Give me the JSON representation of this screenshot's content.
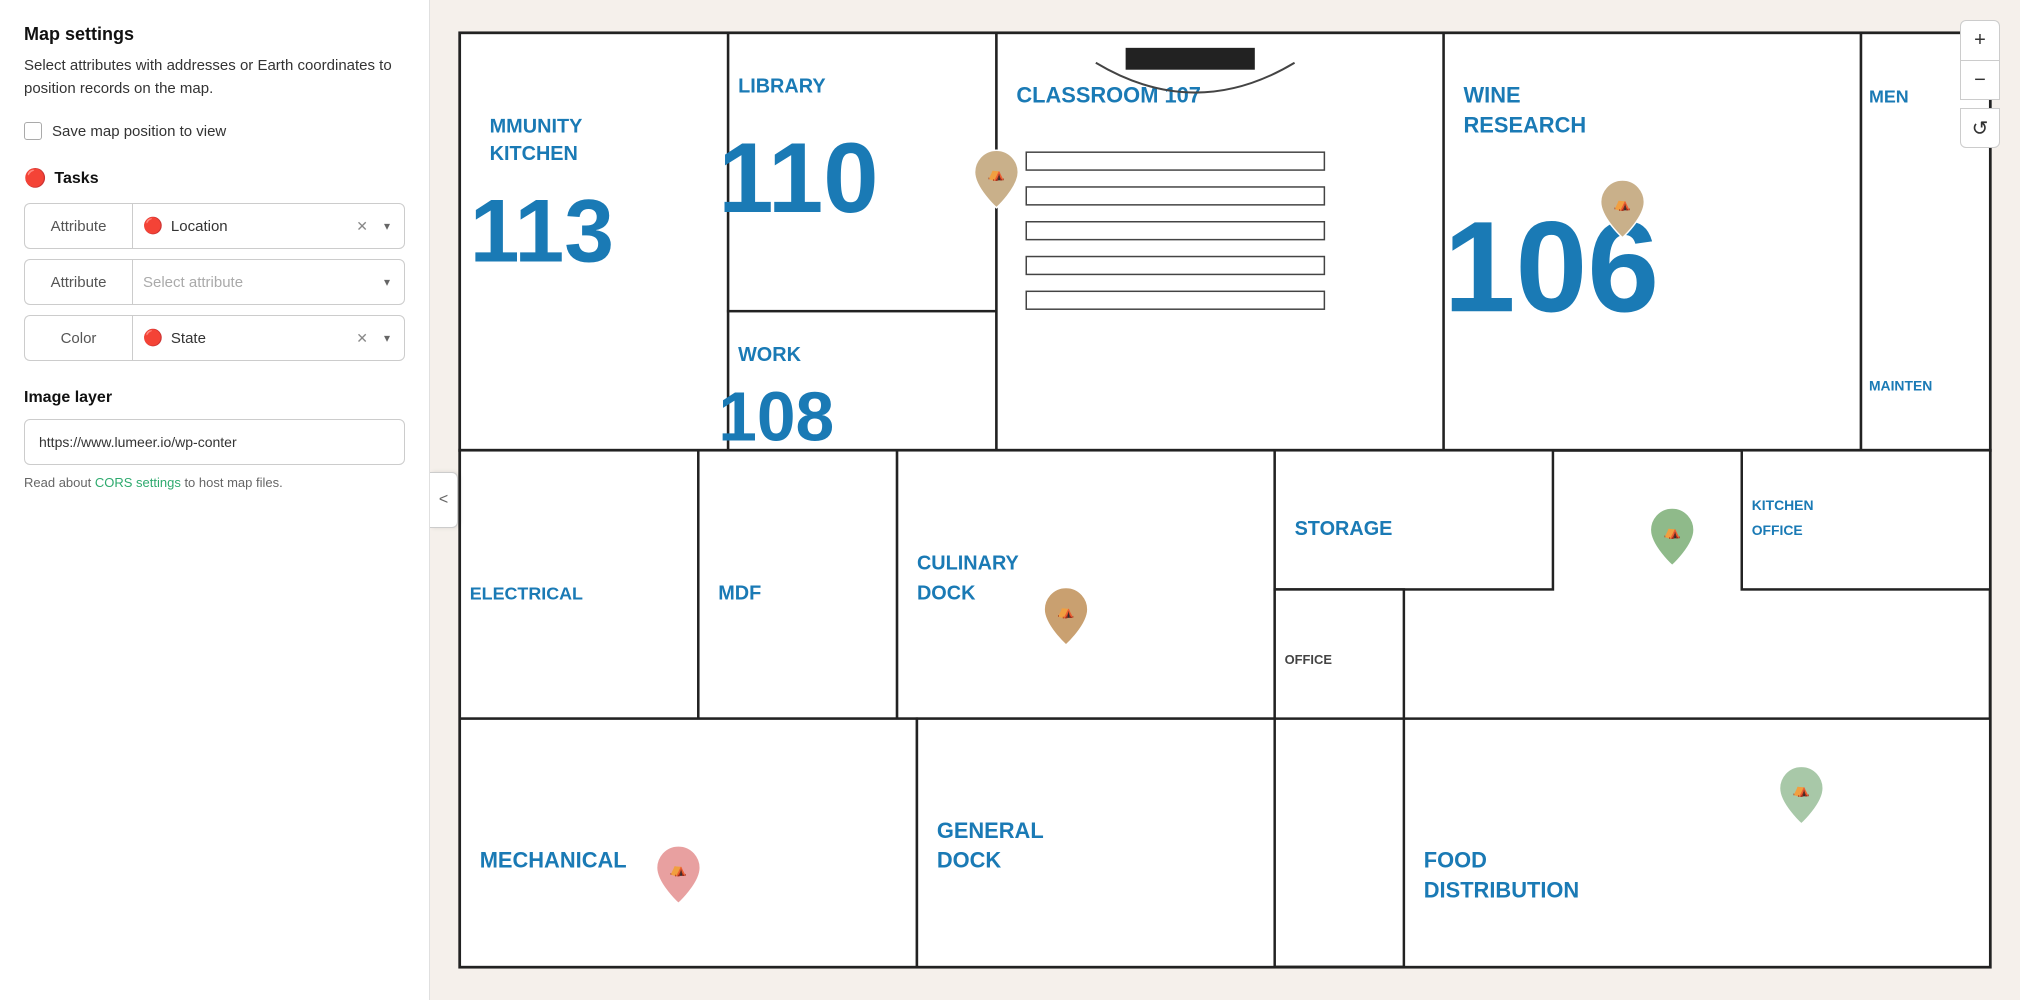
{
  "panel": {
    "title": "Map settings",
    "description": "Select attributes with addresses or Earth coordinates to position records on the map.",
    "save_position_label": "Save map position to view",
    "tasks_section_label": "Tasks",
    "tasks_icon": "🔴",
    "attribute_rows": [
      {
        "id": "row1",
        "label_type": "Attribute",
        "selected_value": "Location",
        "has_value": true,
        "icon": "🔴"
      },
      {
        "id": "row2",
        "label_type": "Attribute",
        "selected_value": "",
        "placeholder": "Select attribute",
        "has_value": false,
        "icon": ""
      },
      {
        "id": "row3",
        "label_type": "Color",
        "selected_value": "State",
        "has_value": true,
        "icon": "🔴"
      }
    ],
    "image_layer_title": "Image layer",
    "image_url_value": "https://www.lumeer.io/wp-conter",
    "cors_note_before": "Read about ",
    "cors_link_text": "CORS settings",
    "cors_note_after": " to host map files."
  },
  "map": {
    "rooms": [
      {
        "id": "r113",
        "name": "MMUNITY\nKITCHEN",
        "number": "113"
      },
      {
        "id": "r110",
        "name": "LIBRARY",
        "number": "110"
      },
      {
        "id": "r107",
        "name": "CLASSROOM 107",
        "number": ""
      },
      {
        "id": "r106",
        "name": "WINE\nRESEARCH",
        "number": "106"
      },
      {
        "id": "r108",
        "name": "WORK",
        "number": "108"
      },
      {
        "id": "electrical",
        "name": "ELECTRICAL",
        "number": ""
      },
      {
        "id": "mdf",
        "name": "MDF",
        "number": ""
      },
      {
        "id": "culinary",
        "name": "CULINARY\nDOCK",
        "number": ""
      },
      {
        "id": "storage",
        "name": "STORAGE",
        "number": ""
      },
      {
        "id": "office",
        "name": "OFFICE",
        "number": ""
      },
      {
        "id": "mechanical",
        "name": "MECHANICAL",
        "number": ""
      },
      {
        "id": "general_dock",
        "name": "GENERAL\nDOCK",
        "number": ""
      },
      {
        "id": "food_dist",
        "name": "FOOD\nDISTRIBUTION",
        "number": ""
      },
      {
        "id": "kitchen_office",
        "name": "KITCHEN\nOFFICE",
        "number": ""
      },
      {
        "id": "men",
        "name": "MEN",
        "number": ""
      },
      {
        "id": "mainten",
        "name": "MAINTEN",
        "number": ""
      }
    ]
  },
  "controls": {
    "zoom_in": "+",
    "zoom_out": "−",
    "reset": "↺",
    "collapse": "<"
  }
}
